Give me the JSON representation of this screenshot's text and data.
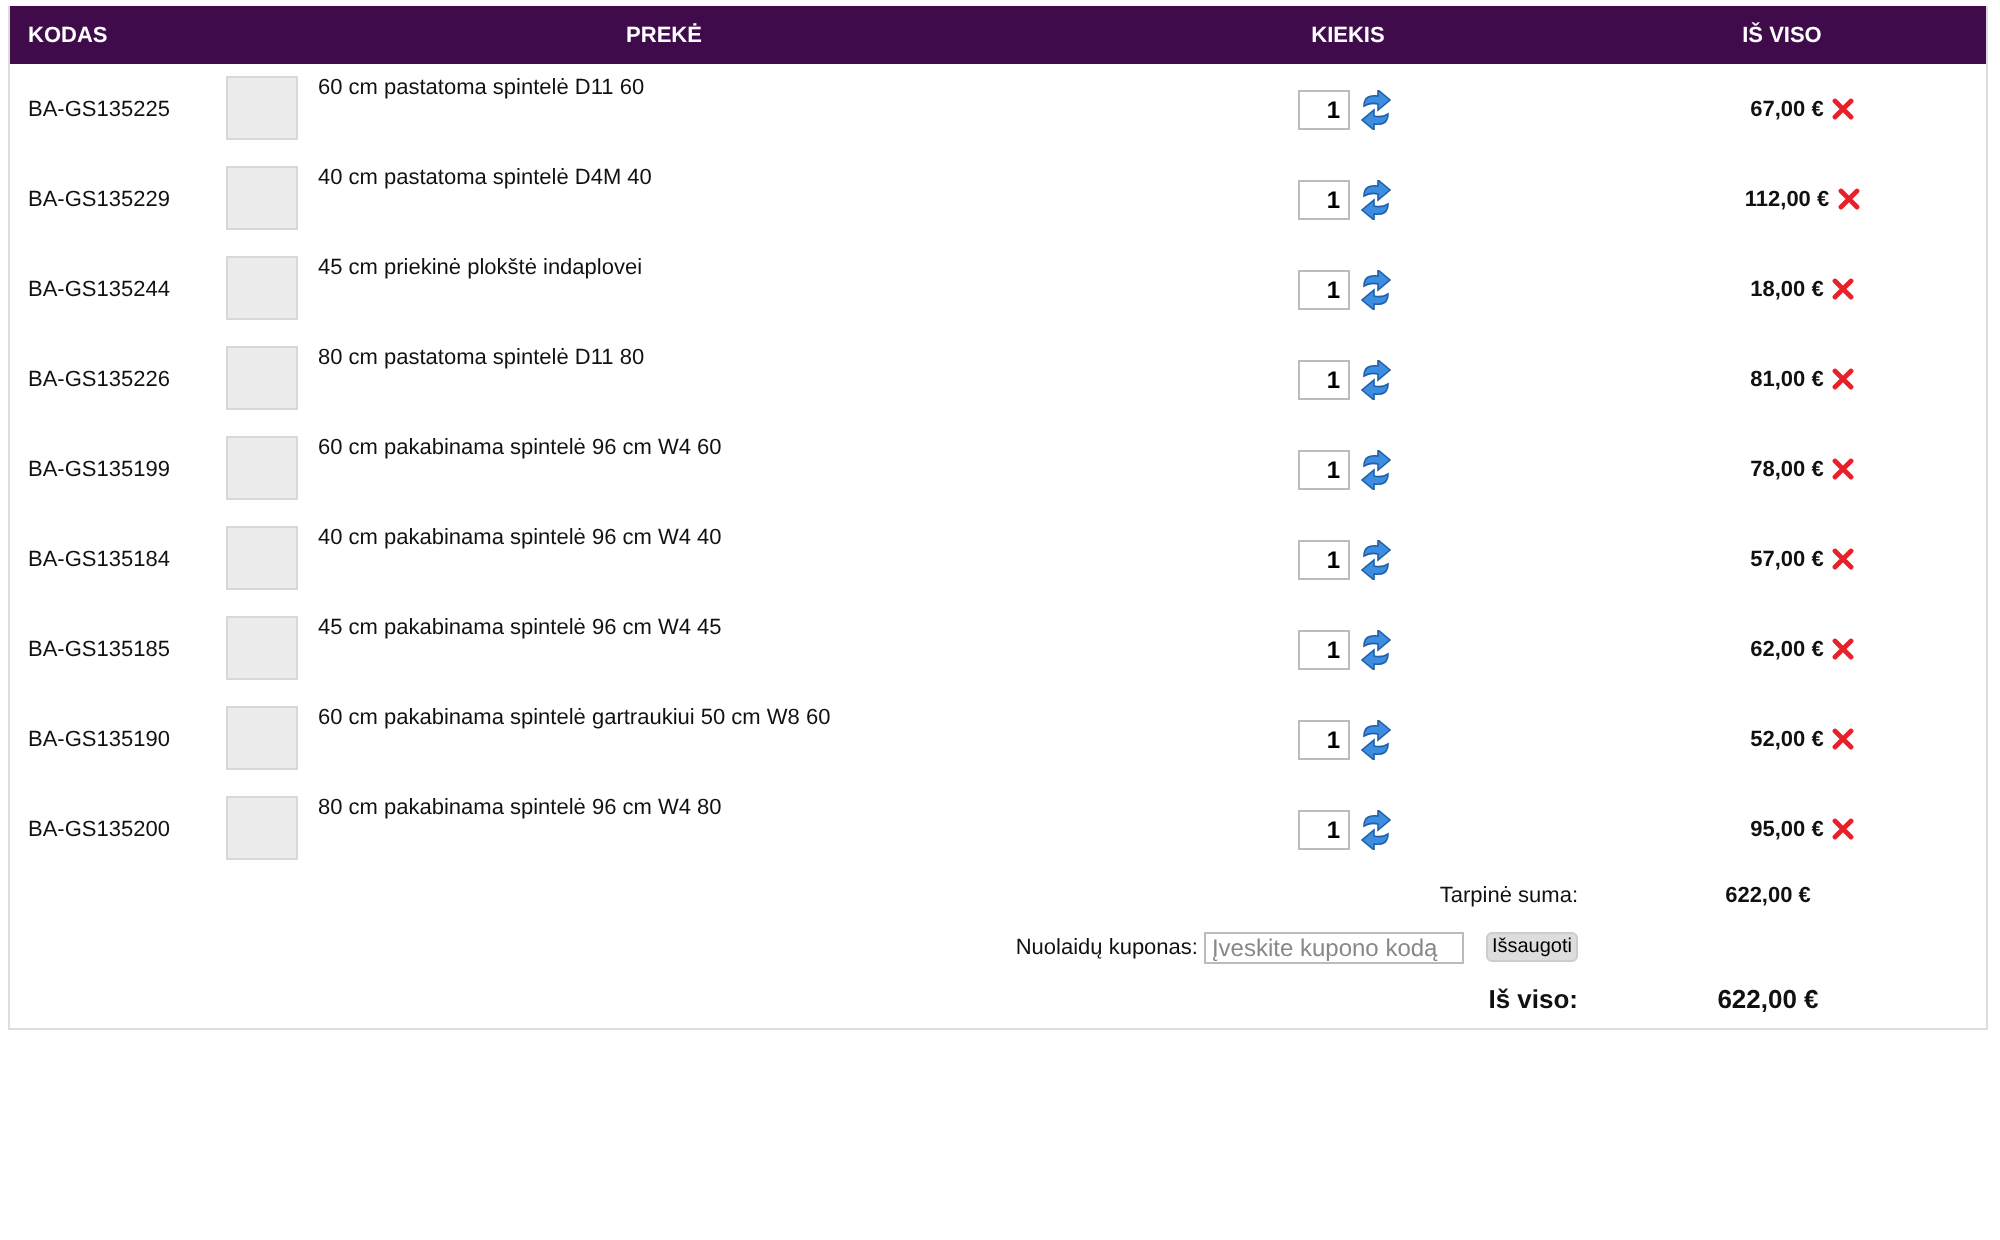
{
  "table": {
    "columns": [
      "KODAS",
      "PREKĖ",
      "KIEKIS",
      "IŠ VISO"
    ],
    "rows": [
      {
        "code": "BA-GS135225",
        "name": "60 cm pastatoma spintelė D11 60",
        "quantity": "1",
        "total": "67,00 €"
      },
      {
        "code": "BA-GS135229",
        "name": "40 cm pastatoma spintelė D4M 40",
        "quantity": "1",
        "total": "112,00 €"
      },
      {
        "code": "BA-GS135244",
        "name": "45 cm priekinė plokštė indaplovei",
        "quantity": "1",
        "total": "18,00 €"
      },
      {
        "code": "BA-GS135226",
        "name": "80 cm pastatoma spintelė D11 80",
        "quantity": "1",
        "total": "81,00 €"
      },
      {
        "code": "BA-GS135199",
        "name": "60 cm pakabinama spintelė 96 cm W4 60",
        "quantity": "1",
        "total": "78,00 €"
      },
      {
        "code": "BA-GS135184",
        "name": "40 cm pakabinama spintelė 96 cm W4 40",
        "quantity": "1",
        "total": "57,00 €"
      },
      {
        "code": "BA-GS135185",
        "name": "45 cm pakabinama spintelė 96 cm W4 45",
        "quantity": "1",
        "total": "62,00 €"
      },
      {
        "code": "BA-GS135190",
        "name": "60 cm pakabinama spintelė gartraukiui 50 cm W8 60",
        "quantity": "1",
        "total": "52,00 €"
      },
      {
        "code": "BA-GS135200",
        "name": "80 cm pakabinama spintelė 96 cm W4 80",
        "quantity": "1",
        "total": "95,00 €"
      }
    ]
  },
  "summary": {
    "subtotal_label": "Tarpinė suma:",
    "subtotal": "622,00 €",
    "coupon_label": "Nuolaidų kuponas:",
    "coupon_placeholder": "Įveskite kupono kodą",
    "save_button": "Išsaugoti",
    "total_label": "Iš viso:",
    "total": "622,00 €"
  }
}
